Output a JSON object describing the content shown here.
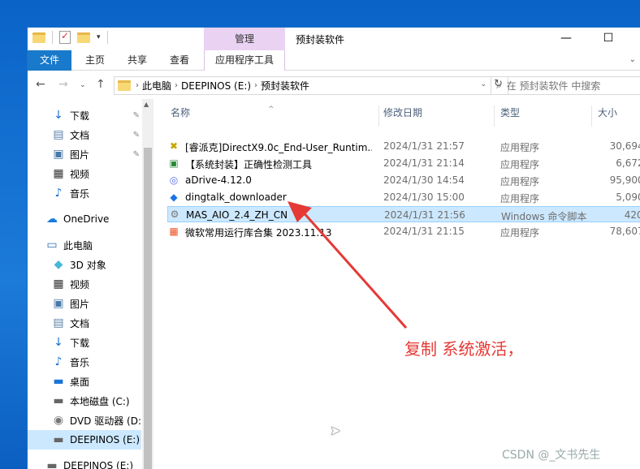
{
  "window": {
    "title": "预封装软件",
    "context_group": "管理",
    "controls": [
      "—",
      "☐"
    ]
  },
  "ribbon": {
    "tabs": [
      "文件",
      "主页",
      "共享",
      "查看"
    ],
    "context_tab": "应用程序工具"
  },
  "address": {
    "crumbs": [
      "此电脑",
      "DEEPINOS (E:)",
      "预封装软件"
    ],
    "search_placeholder": "在 预封装软件 中搜索"
  },
  "nav": {
    "items": [
      {
        "label": "下载",
        "icon": "download-icon",
        "pinned": true
      },
      {
        "label": "文档",
        "icon": "document-icon",
        "pinned": true
      },
      {
        "label": "图片",
        "icon": "pictures-icon",
        "pinned": true
      },
      {
        "label": "视频",
        "icon": "video-icon",
        "pinned": false
      },
      {
        "label": "音乐",
        "icon": "music-icon",
        "pinned": false
      },
      {
        "label": "OneDrive",
        "icon": "onedrive-icon",
        "pinned": false
      },
      {
        "label": "此电脑",
        "icon": "pc-icon",
        "pinned": false
      },
      {
        "label": "3D 对象",
        "icon": "3d-icon",
        "pinned": false
      },
      {
        "label": "视频",
        "icon": "video-icon",
        "pinned": false
      },
      {
        "label": "图片",
        "icon": "pictures-icon",
        "pinned": false
      },
      {
        "label": "文档",
        "icon": "document-icon",
        "pinned": false
      },
      {
        "label": "下载",
        "icon": "download-icon",
        "pinned": false
      },
      {
        "label": "音乐",
        "icon": "music-icon",
        "pinned": false
      },
      {
        "label": "桌面",
        "icon": "desktop-icon",
        "pinned": false
      },
      {
        "label": "本地磁盘 (C:)",
        "icon": "drive-icon",
        "pinned": false
      },
      {
        "label": "DVD 驱动器 (D:",
        "icon": "dvd-icon",
        "pinned": false
      },
      {
        "label": "DEEPINOS (E:)",
        "icon": "drive-icon",
        "pinned": false
      },
      {
        "label": "DEEPINOS (E:)",
        "icon": "drive-icon",
        "pinned": false
      }
    ]
  },
  "columns": {
    "name": "名称",
    "date": "修改日期",
    "type": "类型",
    "size": "大小"
  },
  "files": [
    {
      "name": "[睿派克]DirectX9.0c_End-User_Runtim...",
      "date": "2024/1/31 21:57",
      "type": "应用程序",
      "size": "30,694 I",
      "icon": "directx-icon"
    },
    {
      "name": "【系统封装】正确性检测工具",
      "date": "2024/1/31 21:14",
      "type": "应用程序",
      "size": "6,672 I",
      "icon": "tool-icon"
    },
    {
      "name": "aDrive-4.12.0",
      "date": "2024/1/30 14:54",
      "type": "应用程序",
      "size": "95,900 I",
      "icon": "adrive-icon"
    },
    {
      "name": "dingtalk_downloader",
      "date": "2024/1/30 15:00",
      "type": "应用程序",
      "size": "5,090 I",
      "icon": "dingtalk-icon"
    },
    {
      "name": "MAS_AIO_2.4_ZH_CN",
      "date": "2024/1/31 21:56",
      "type": "Windows 命令脚本",
      "size": "420 I",
      "icon": "script-icon"
    },
    {
      "name": "微软常用运行库合集 2023.11.13",
      "date": "2024/1/31 21:15",
      "type": "应用程序",
      "size": "78,607 I",
      "icon": "windows-icon"
    }
  ],
  "annotation": "复制 系统激活，",
  "watermark": "CSDN @_文书先生",
  "colors": {
    "accent": "#1979ca",
    "context": "#e9d2f2",
    "selection": "#cce8ff",
    "annotation": "#e53935"
  }
}
